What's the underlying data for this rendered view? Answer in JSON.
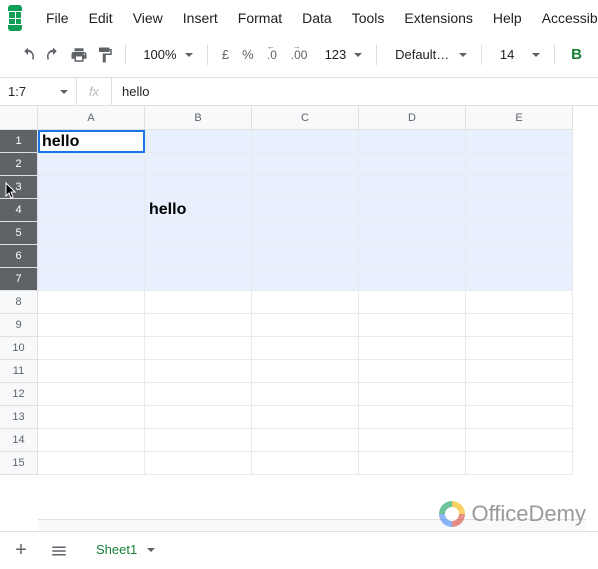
{
  "menu": [
    "File",
    "Edit",
    "View",
    "Insert",
    "Format",
    "Data",
    "Tools",
    "Extensions",
    "Help",
    "Accessibility"
  ],
  "toolbar": {
    "zoom": "100%",
    "currency": "£",
    "percent": "%",
    "dec_dec": ".0",
    "inc_dec": ".00",
    "num_fmt": "123",
    "font": "Default (Ari...",
    "font_size": "14",
    "bold": "B"
  },
  "namebox": "1:7",
  "fx_label": "fx",
  "formula": "hello",
  "columns": [
    "A",
    "B",
    "C",
    "D",
    "E"
  ],
  "total_rows": 15,
  "selected_rows": [
    1,
    2,
    3,
    4,
    5,
    6,
    7
  ],
  "active_cell": {
    "row": 1,
    "col": "A"
  },
  "cells": {
    "A1": "hello",
    "B4": "hello"
  },
  "sheet_tab": "Sheet1",
  "watermark": "OfficeDemy"
}
